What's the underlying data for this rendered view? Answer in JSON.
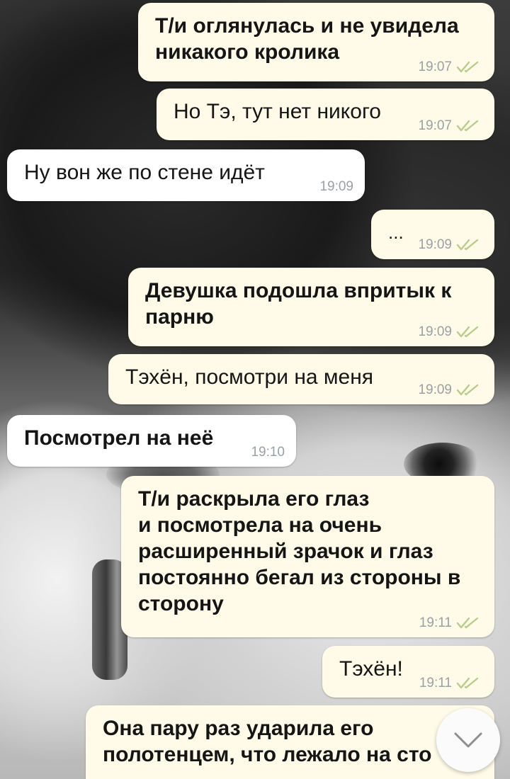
{
  "messages": [
    {
      "id": "m1",
      "direction": "outgoing",
      "bold": true,
      "text": "Т/и оглянулась и не увидела\nникакого кролика",
      "time": "19:07",
      "read": true
    },
    {
      "id": "m2",
      "direction": "outgoing",
      "bold": false,
      "text": "Но Тэ, тут нет никого",
      "time": "19:07",
      "read": true
    },
    {
      "id": "m3",
      "direction": "incoming",
      "bold": false,
      "text": "Ну вон же по стене идёт",
      "time": "19:09"
    },
    {
      "id": "m4",
      "direction": "outgoing",
      "bold": false,
      "text": "...",
      "time": "19:09",
      "read": true
    },
    {
      "id": "m5",
      "direction": "outgoing",
      "bold": true,
      "text": "Девушка подошла впритык к\nпарню",
      "time": "19:09",
      "read": true
    },
    {
      "id": "m6",
      "direction": "outgoing",
      "bold": false,
      "text": "Тэхён, посмотри на меня",
      "time": "19:09",
      "read": true
    },
    {
      "id": "m7",
      "direction": "incoming",
      "bold": true,
      "text": "Посмотрел на неё",
      "time": "19:10"
    },
    {
      "id": "m8",
      "direction": "outgoing",
      "bold": true,
      "text": "Т/и раскрыла его глаз\nи посмотрела на очень\nрасширенный зрачок и глаз\nпостоянно бегал из стороны в\nсторону",
      "time": "19:11",
      "read": true
    },
    {
      "id": "m9",
      "direction": "outgoing",
      "bold": false,
      "text": "Тэхён!",
      "time": "19:11",
      "read": true
    },
    {
      "id": "m10",
      "direction": "outgoing",
      "bold": true,
      "text": "Она пару раз ударила его\nполотенцем, что лежало на сто",
      "time": "",
      "read": false
    }
  ],
  "icons": {
    "read_ticks": "double-check-icon",
    "scroll_down": "chevron-down-icon"
  },
  "colors": {
    "outgoing_bubble": "#fffbe8",
    "incoming_bubble": "#ffffff",
    "meta_text": "#9aa0a6",
    "read_ticks": "#b9cc8c"
  }
}
